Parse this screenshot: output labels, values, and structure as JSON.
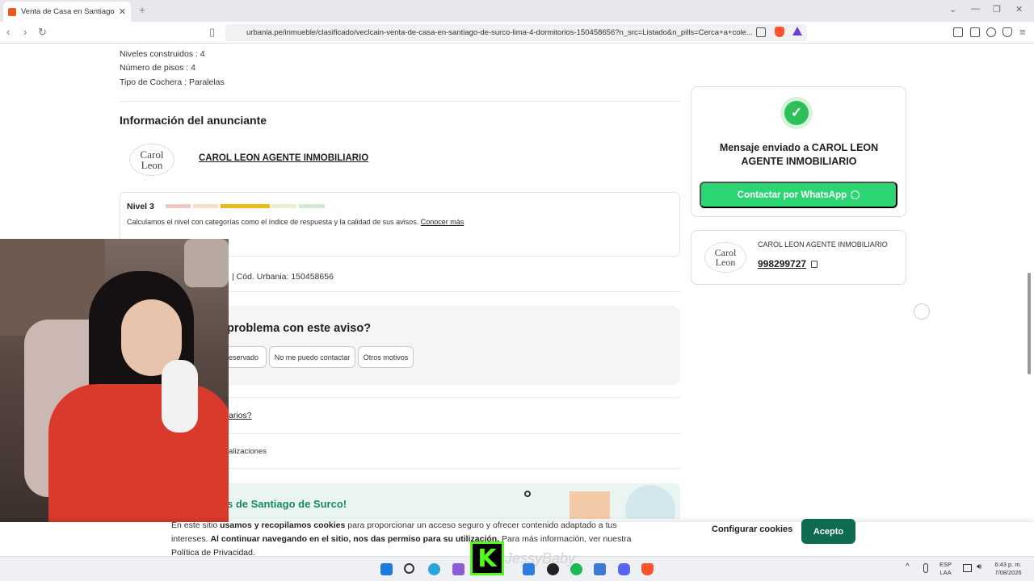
{
  "browser": {
    "tab_title": "Venta de Casa en Santiago de Surco",
    "url": "urbania.pe/inmueble/clasificado/veclcain-venta-de-casa-en-santiago-de-surco-lima-4-dormitorios-150458656?n_src=Listado&n_pills=Cerca+a+cole..."
  },
  "details": {
    "line1": "Niveles construidos : 4",
    "line2": "Número de pisos : 4",
    "line3": "Tipo de Cochera : Paralelas"
  },
  "advertiser": {
    "section_title": "Información del anunciante",
    "logo_line1": "Carol",
    "logo_line2": "Leon",
    "name": "CAROL LEON AGENTE INMOBILIARIO",
    "level_title": "Nivel 3",
    "level_desc": "Calculamos el nivel con categorías como el índice de respuesta y la calidad de sus avisos.",
    "level_link": "Conocer más",
    "level_value": 3,
    "level_max": 6,
    "code_text": "| Cód. Urbania: 150458656"
  },
  "problem": {
    "title": "problema con este aviso?",
    "chips": [
      "reservado",
      "No me puedo contactar",
      "Otros motivos"
    ]
  },
  "faq": {
    "q1": "arios?",
    "q2": "alizaciones"
  },
  "banner": {
    "title": "s de Santiago de Surco!"
  },
  "sidebar": {
    "message": "Mensaje enviado a CAROL LEON AGENTE INMOBILIARIO",
    "whatsapp_label": "Contactar por WhatsApp",
    "contact_name": "CAROL LEON AGENTE INMOBILIARIO",
    "contact_phone": "998299727"
  },
  "cookies": {
    "text_a": "En este sitio ",
    "text_b": "usamos y recopilamos cookies",
    "text_c": " para proporcionar un acceso seguro y ofrecer contenido adaptado a tus intereses. ",
    "text_d": "Al continuar navegando en el sitio, nos das permiso para su utilización.",
    "text_e": " Para más información, ver nuestra ",
    "policy_link": "Política de Privacidad.",
    "configure_label": "Configurar cookies",
    "accept_label": "Acepto"
  },
  "overlay": {
    "kick_letter": "K",
    "streamer_name": "JessyBaby"
  },
  "taskbar": {
    "lang1": "ESP",
    "lang2": "LAA",
    "time": "6:43 p. m.",
    "date": "7/08/2026"
  },
  "colors": {
    "accent_green": "#0e6b51",
    "whatsapp_green": "#2bd672",
    "banner_green": "#15886a"
  }
}
